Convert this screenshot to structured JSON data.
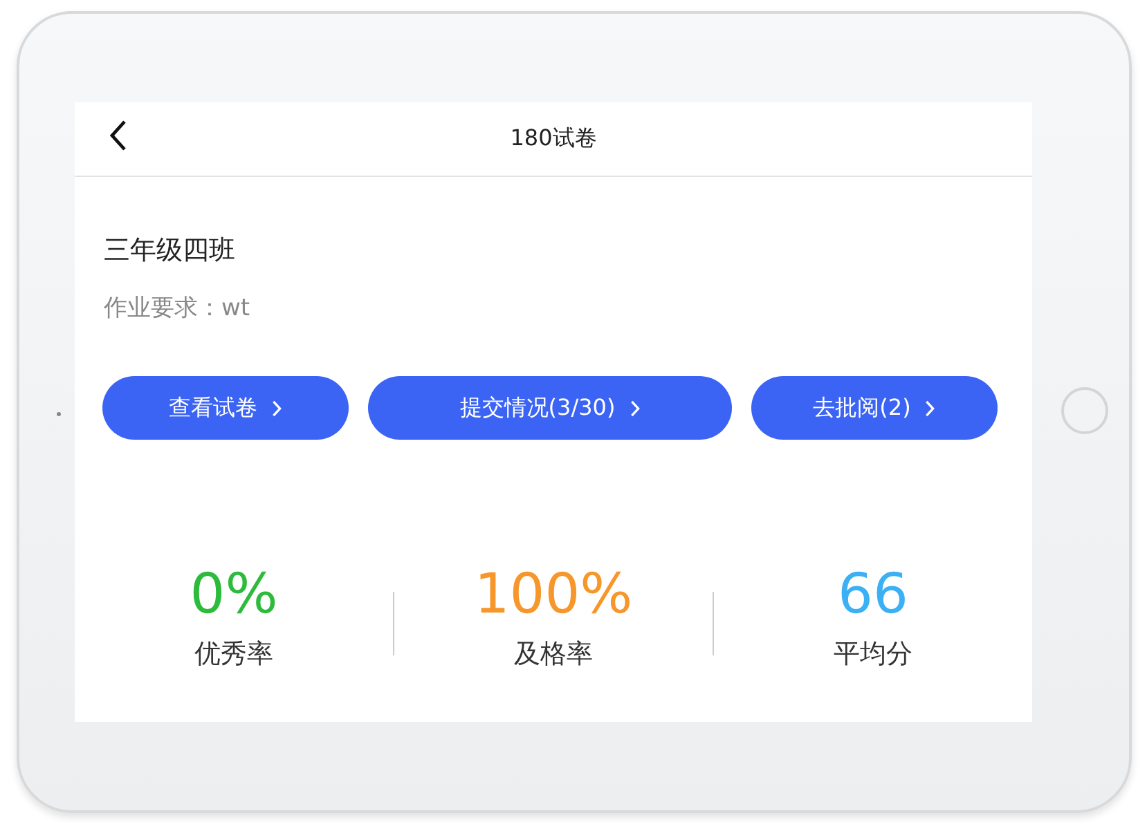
{
  "header": {
    "title": "180试卷"
  },
  "class_name": "三年级四班",
  "requirement": "作业要求：wt",
  "buttons": [
    {
      "label": "查看试卷"
    },
    {
      "label": "提交情况(3/30)"
    },
    {
      "label": "去批阅(2)"
    }
  ],
  "stats": [
    {
      "value": "0%",
      "label": "优秀率",
      "color": "#2dbb3c"
    },
    {
      "value": "100%",
      "label": "及格率",
      "color": "#f7962a"
    },
    {
      "value": "66",
      "label": "平均分",
      "color": "#3bb0f5"
    }
  ]
}
